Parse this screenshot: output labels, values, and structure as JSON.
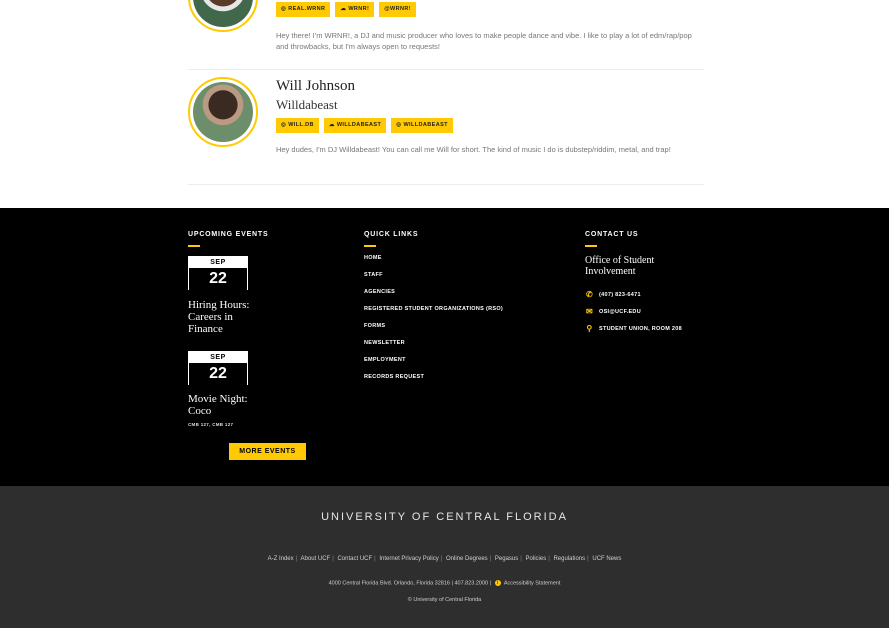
{
  "profiles": [
    {
      "name": "",
      "alias": "",
      "tags": [
        {
          "icon": "instagram-icon",
          "glyph": "◎",
          "label": "REAL.WRNR"
        },
        {
          "icon": "soundcloud-icon",
          "glyph": "☁",
          "label": "WRNR!"
        },
        {
          "icon": "twitter-icon",
          "glyph": "",
          "label": "@WRNR!"
        }
      ],
      "bio": "Hey there! I'm WRNR!, a DJ and music producer who loves to make people dance and vibe. I like to play a lot of edm/rap/pop and throwbacks, but I'm always open to requests!"
    },
    {
      "name": "Will Johnson",
      "alias": "Willdabeast",
      "tags": [
        {
          "icon": "instagram-icon",
          "glyph": "◎",
          "label": "WILL.DB"
        },
        {
          "icon": "soundcloud-icon",
          "glyph": "☁",
          "label": "WILLDABEAST"
        },
        {
          "icon": "twitter-icon",
          "glyph": "◎",
          "label": "WILLDABEAST"
        }
      ],
      "bio": "Hey dudes, I'm DJ Willdabeast! You can call me Will for short. The kind of music I do is dubstep/riddim, metal, and trap!"
    }
  ],
  "footer": {
    "upcoming_heading": "UPCOMING EVENTS",
    "events": [
      {
        "month": "SEP",
        "day": "22",
        "title": "Hiring Hours: Careers in Finance",
        "location": ""
      },
      {
        "month": "SEP",
        "day": "22",
        "title": "Movie Night: Coco",
        "location": "CMB 127, CMB 127"
      }
    ],
    "more_events": "MORE EVENTS",
    "quick_heading": "QUICK LINKS",
    "quick_links": [
      "HOME",
      "STAFF",
      "AGENCIES",
      "REGISTERED STUDENT ORGANIZATIONS (RSO)",
      "FORMS",
      "NEWSLETTER",
      "EMPLOYMENT",
      "RECORDS REQUEST"
    ],
    "contact_heading": "CONTACT US",
    "office": "Office of Student Involvement",
    "contacts": [
      {
        "icon": "phone-icon",
        "glyph": "✆",
        "text": "(407) 823-6471"
      },
      {
        "icon": "envelope-icon",
        "glyph": "✉",
        "text": "OSI@UCF.EDU"
      },
      {
        "icon": "map-pin-icon",
        "glyph": "⚲",
        "text": "STUDENT UNION, ROOM 208"
      }
    ]
  },
  "bottom": {
    "university": "UNIVERSITY OF CENTRAL FLORIDA",
    "links": [
      "A-Z Index",
      "About UCF",
      "Contact UCF",
      "Internet Privacy Policy",
      "Online Degrees",
      "Pegasus",
      "Policies",
      "Regulations",
      "UCF News"
    ],
    "address": "4000 Central Florida Blvd. Orlando, Florida 32816 | 407.823.2000 |",
    "accessibility": "Accessibility Statement",
    "copyright": "© University of Central Florida"
  },
  "colors": {
    "accent": "#ffc904",
    "dark": "#000000",
    "bottom_bg": "#2e2e2e"
  }
}
